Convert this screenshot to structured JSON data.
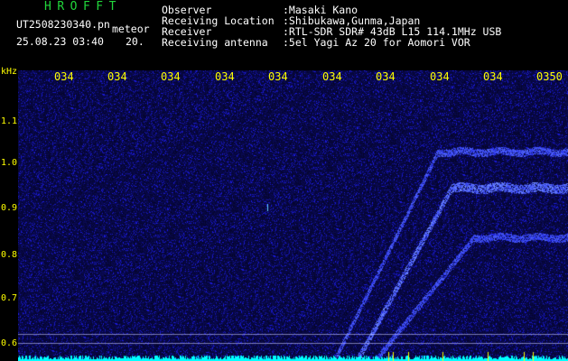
{
  "header": {
    "brand": "HROFFT",
    "filename": "UT2508230340.pn",
    "filename_suffix": "meteor",
    "datetime": "25.08.23 03:40",
    "count": "20.",
    "fields": [
      {
        "label": "Observer",
        "value": ":Masaki Kano"
      },
      {
        "label": "Receiving Location",
        "value": ":Shibukawa,Gunma,Japan"
      },
      {
        "label": "Receiver",
        "value": ":RTL-SDR SDR# 43dB L15 114.1MHz USB"
      },
      {
        "label": "Receiving antenna",
        "value": ":5el Yagi Az 20 for Aomori VOR"
      }
    ]
  },
  "y_axis": {
    "unit": "kHz",
    "ticks": [
      "1.1",
      "1.0",
      "0.9",
      "0.8",
      "0.7",
      "0.6"
    ]
  },
  "time_ticks": [
    "034",
    "034",
    "034",
    "034",
    "034",
    "034",
    "034",
    "034",
    "034",
    "0350"
  ],
  "colors": {
    "background": "#000000",
    "spectrogram_bg": "#000030",
    "noise_blue": "#2a2aff",
    "signal": "#7fa0ff",
    "labels": "#ffff00",
    "brand_green": "#21d63b",
    "baseline": "#00ffff"
  }
}
